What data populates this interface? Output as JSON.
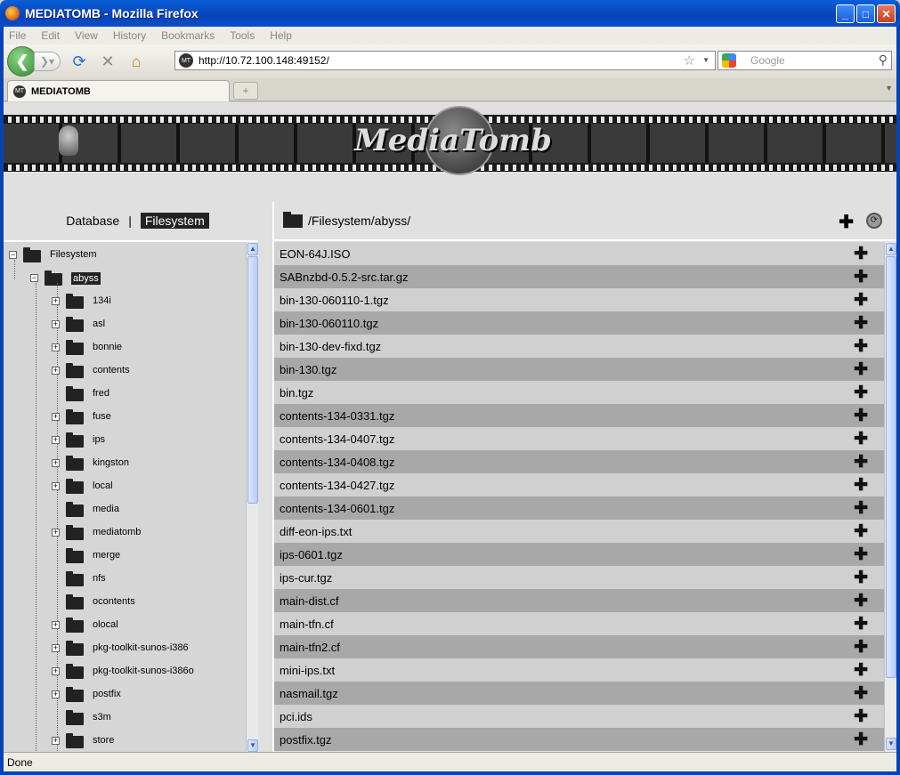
{
  "window": {
    "title": "MEDIATOMB - Mozilla Firefox"
  },
  "menu": [
    "File",
    "Edit",
    "View",
    "History",
    "Bookmarks",
    "Tools",
    "Help"
  ],
  "nav": {
    "url": "http://10.72.100.148:49152/",
    "search_placeholder": "Google"
  },
  "tab": {
    "label": "MEDIATOMB"
  },
  "app": {
    "logo_text": "MediaTomb",
    "view_database": "Database",
    "view_separator": "|",
    "view_filesystem": "Filesystem",
    "path": "/Filesystem/abyss/"
  },
  "tree": {
    "root": "Filesystem",
    "selected": "abyss",
    "children": [
      {
        "name": "134i",
        "expandable": true
      },
      {
        "name": "asl",
        "expandable": true
      },
      {
        "name": "bonnie",
        "expandable": true
      },
      {
        "name": "contents",
        "expandable": true
      },
      {
        "name": "fred",
        "expandable": false
      },
      {
        "name": "fuse",
        "expandable": true
      },
      {
        "name": "ips",
        "expandable": true
      },
      {
        "name": "kingston",
        "expandable": true
      },
      {
        "name": "local",
        "expandable": true
      },
      {
        "name": "media",
        "expandable": false
      },
      {
        "name": "mediatomb",
        "expandable": true
      },
      {
        "name": "merge",
        "expandable": false
      },
      {
        "name": "nfs",
        "expandable": false
      },
      {
        "name": "ocontents",
        "expandable": false
      },
      {
        "name": "olocal",
        "expandable": true
      },
      {
        "name": "pkg-toolkit-sunos-i386",
        "expandable": true
      },
      {
        "name": "pkg-toolkit-sunos-i386o",
        "expandable": true
      },
      {
        "name": "postfix",
        "expandable": true
      },
      {
        "name": "s3m",
        "expandable": false
      },
      {
        "name": "store",
        "expandable": true
      }
    ]
  },
  "files": [
    "EON-64J.ISO",
    "SABnzbd-0.5.2-src.tar.gz",
    "bin-130-060110-1.tgz",
    "bin-130-060110.tgz",
    "bin-130-dev-fixd.tgz",
    "bin-130.tgz",
    "bin.tgz",
    "contents-134-0331.tgz",
    "contents-134-0407.tgz",
    "contents-134-0408.tgz",
    "contents-134-0427.tgz",
    "contents-134-0601.tgz",
    "diff-eon-ips.txt",
    "ips-0601.tgz",
    "ips-cur.tgz",
    "main-dist.cf",
    "main-tfn.cf",
    "main-tfn2.cf",
    "mini-ips.txt",
    "nasmail.tgz",
    "pci.ids",
    "postfix.tgz"
  ],
  "status": "Done"
}
